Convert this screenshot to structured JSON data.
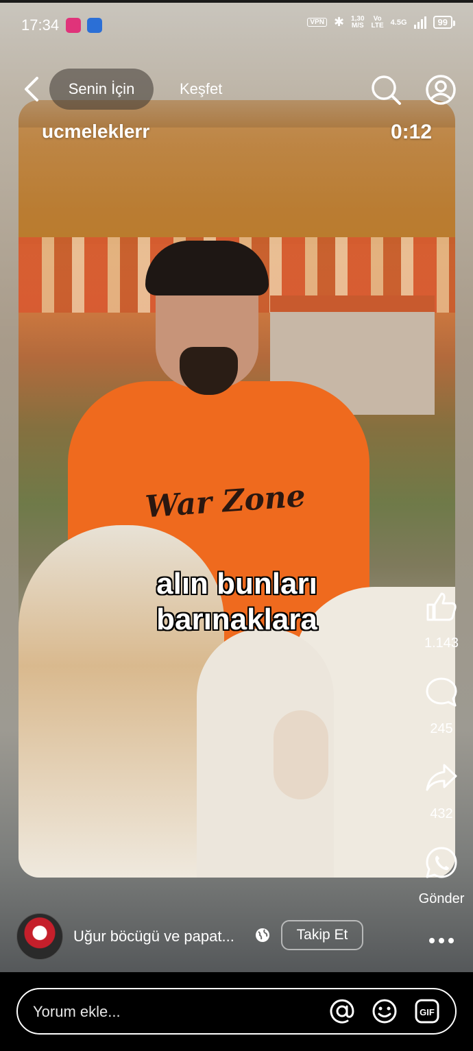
{
  "status_bar": {
    "time": "17:34",
    "vpn_label": "VPN",
    "speed_value": "1,30",
    "speed_unit": "M/S",
    "volte_top": "Vo",
    "volte_bottom": "LTE",
    "network": "4.5G",
    "battery": "99",
    "icons": [
      "app-notification-icon",
      "shield-icon",
      "bluetooth-icon",
      "signal-icon"
    ]
  },
  "nav": {
    "tabs": [
      {
        "label": "Senin İçin",
        "active": true
      },
      {
        "label": "Keşfet",
        "active": false
      }
    ],
    "icons": [
      "back-arrow-icon",
      "search-icon",
      "profile-icon"
    ]
  },
  "video": {
    "uploader": "ucmeleklerr",
    "timer": "0:12",
    "caption_line1": "alın bunları",
    "caption_line2": "barınaklara",
    "shirt_print": "War Zone"
  },
  "actions": {
    "like_count": "1.143",
    "comment_count": "245",
    "share_count": "432",
    "send_label": "Gönder"
  },
  "info": {
    "sound_title": "Uğur böcügü ve papat...",
    "follow_label": "Takip Et"
  },
  "comment_bar": {
    "placeholder": "Yorum ekle...",
    "icons": [
      "mention-icon",
      "emoji-icon",
      "gif-icon"
    ]
  },
  "colors": {
    "shirt": "#ef6a1e",
    "accent_white": "#ffffff",
    "bottom_bar": "#000000"
  }
}
